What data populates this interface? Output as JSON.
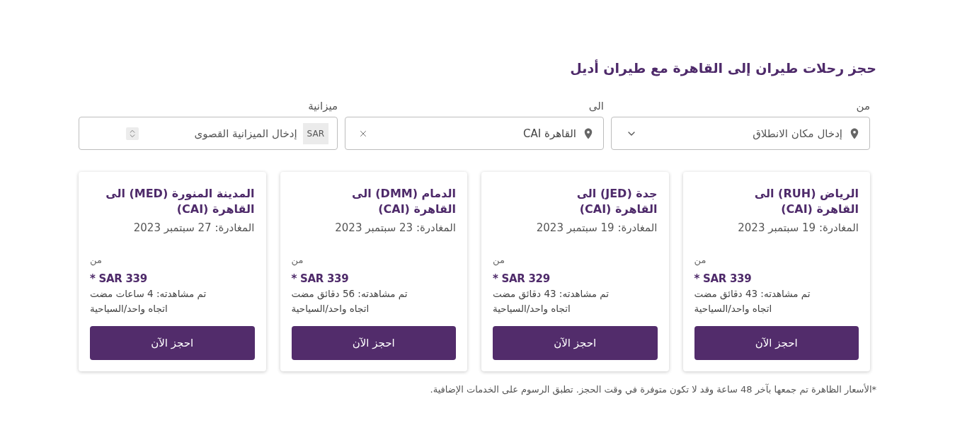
{
  "heading": "حجز رحلات طيران إلى القاهرة مع طيران أديل",
  "search": {
    "fields": [
      {
        "kind": "select",
        "label": "من",
        "placeholder": "إدخال مكان الانطلاق"
      },
      {
        "kind": "location",
        "label": "الى",
        "value": "القاهرة CAI"
      },
      {
        "kind": "budget",
        "label": "ميزانية",
        "currency": "SAR",
        "placeholder": "إدخال الميزانية القصوى"
      }
    ]
  },
  "cards": [
    {
      "title": "الرياض (RUH) الى\nالقاهرة (CAI)",
      "departure": "المغادرة: 19 سبتمبر 2023",
      "from_label": "من",
      "price": "SAR 339 *",
      "viewed": "تم مشاهدته: 43 دقائق مضت",
      "fare_type": "اتجاه واحد/السياحية",
      "button": "احجز الآن"
    },
    {
      "title": "جدة (JED) الى\nالقاهرة (CAI)",
      "departure": "المغادرة: 19 سبتمبر 2023",
      "from_label": "من",
      "price": "SAR 329 *",
      "viewed": "تم مشاهدته: 43 دقائق مضت",
      "fare_type": "اتجاه واحد/السياحية",
      "button": "احجز الآن"
    },
    {
      "title": "الدمام (DMM) الى\nالقاهرة (CAI)",
      "departure": "المغادرة: 23 سبتمبر 2023",
      "from_label": "من",
      "price": "SAR 339 *",
      "viewed": "تم مشاهدته: 56 دقائق مضت",
      "fare_type": "اتجاه واحد/السياحية",
      "button": "احجز الآن"
    },
    {
      "title": "المدينة المنورة (MED) الى\nالقاهرة (CAI)",
      "departure": "المغادرة: 27 سبتمبر 2023",
      "from_label": "من",
      "price": "SAR 339 *",
      "viewed": "تم مشاهدته: 4 ساعات مضت",
      "fare_type": "اتجاه واحد/السياحية",
      "button": "احجز الآن"
    }
  ],
  "footnote": "*الأسعار الظاهرة تم جمعها بآخر 48 ساعة وقد لا تكون متوفرة في وقت الحجز. تطبق الرسوم على الخدمات الإضافية."
}
